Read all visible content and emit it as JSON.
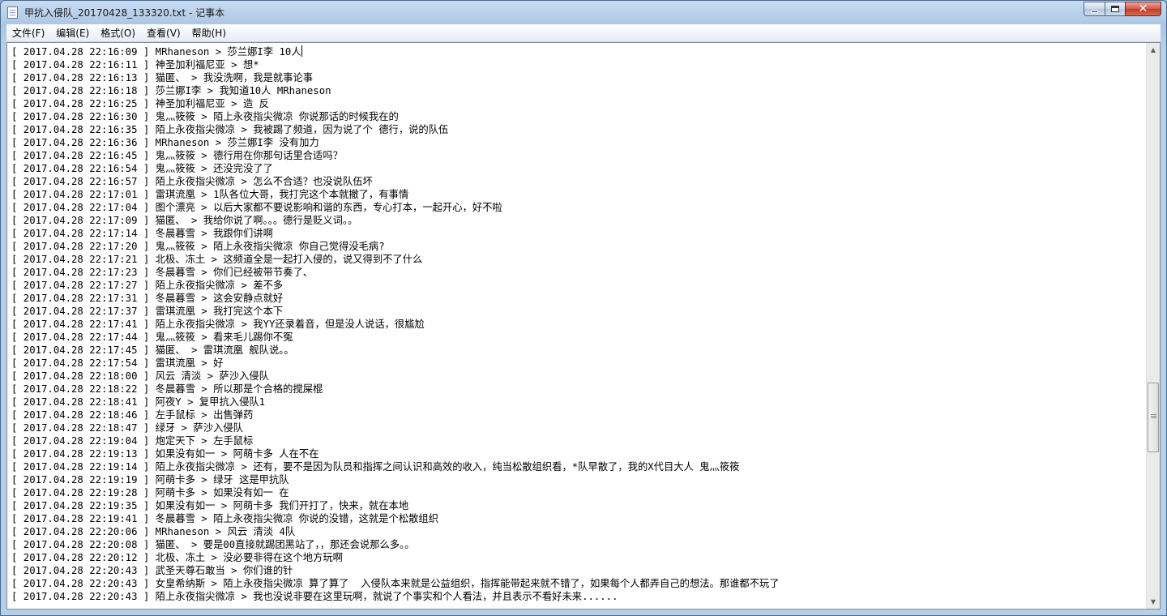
{
  "window": {
    "title": "甲抗入侵队_20170428_133320.txt - 记事本",
    "icon": "notepad-icon",
    "close_glyph": "✕"
  },
  "menu": [
    "文件(F)",
    "编辑(E)",
    "格式(O)",
    "查看(V)",
    "帮助(H)"
  ],
  "lines": [
    "[ 2017.04.28 22:16:09 ] MRhaneson > 莎兰娜I李 10人",
    "[ 2017.04.28 22:16:11 ] 神圣加利福尼亚 > 想*",
    "[ 2017.04.28 22:16:13 ] 猫匿、 > 我没洗啊，我是就事论事",
    "[ 2017.04.28 22:16:18 ] 莎兰娜I李 > 我知道10人 MRhaneson",
    "[ 2017.04.28 22:16:25 ] 神圣加利福尼亚 > 造 反",
    "[ 2017.04.28 22:16:30 ] 鬼灬筱筱 > 陌上永夜指尖微凉 你说那话的时候我在的",
    "[ 2017.04.28 22:16:35 ] 陌上永夜指尖微凉 > 我被踢了频道，因为说了个 德行，说的队伍",
    "[ 2017.04.28 22:16:36 ] MRhaneson > 莎兰娜I李 没有加力",
    "[ 2017.04.28 22:16:45 ] 鬼灬筱筱 > 德行用在你那句话里合适吗？",
    "[ 2017.04.28 22:16:54 ] 鬼灬筱筱 > 还没完没了了",
    "[ 2017.04.28 22:16:57 ] 陌上永夜指尖微凉 > 怎么不合适？也没说队伍坏",
    "[ 2017.04.28 22:17:01 ] 雷琪流凰 > 1队各位大哥，我打完这个本就撤了，有事情",
    "[ 2017.04.28 22:17:04 ] 图个漂亮 > 以后大家都不要说影响和谐的东西，专心打本，一起开心，好不啦",
    "[ 2017.04.28 22:17:09 ] 猫匿、 > 我给你说了啊。。。德行是贬义词。。",
    "[ 2017.04.28 22:17:14 ] 冬晨暮雪 > 我跟你们讲啊",
    "[ 2017.04.28 22:17:20 ] 鬼灬筱筱 > 陌上永夜指尖微凉 你自己觉得没毛病?",
    "[ 2017.04.28 22:17:21 ] 北极、冻土 > 这频道全是一起打入侵的，说又得到不了什么",
    "[ 2017.04.28 22:17:23 ] 冬晨暮雪 > 你们已经被带节奏了、",
    "[ 2017.04.28 22:17:27 ] 陌上永夜指尖微凉 > 差不多",
    "[ 2017.04.28 22:17:31 ] 冬晨暮雪 > 这会安静点就好",
    "[ 2017.04.28 22:17:37 ] 雷琪流凰 > 我打完这个本下",
    "[ 2017.04.28 22:17:41 ] 陌上永夜指尖微凉 > 我YY还录着音，但是没人说话，很尴尬",
    "[ 2017.04.28 22:17:44 ] 鬼灬筱筱 > 看来毛儿踢你不冤",
    "[ 2017.04.28 22:17:45 ] 猫匿、 > 雷琪流凰 舰队说。。",
    "[ 2017.04.28 22:17:54 ] 雷琪流凰 > 好",
    "[ 2017.04.28 22:18:00 ] 风云 清淡 > 萨沙入侵队",
    "[ 2017.04.28 22:18:22 ] 冬晨暮雪 > 所以那是个合格的搅屎棍",
    "[ 2017.04.28 22:18:41 ] 阿夜Y > 复甲抗入侵队1",
    "[ 2017.04.28 22:18:46 ] 左手鼠标 > 出售弹药",
    "[ 2017.04.28 22:18:47 ] 绿牙 > 萨沙入侵队",
    "[ 2017.04.28 22:19:04 ] 炮定天下 > 左手鼠标",
    "[ 2017.04.28 22:19:13 ] 如果没有如一 > 阿萌卡多 人在不在",
    "[ 2017.04.28 22:19:14 ] 陌上永夜指尖微凉 > 还有，要不是因为队员和指挥之间认识和高效的收入，纯当松散组织看，*队早散了，我的X代目大人 鬼灬筱筱",
    "[ 2017.04.28 22:19:19 ] 阿萌卡多 > 绿牙 这是甲抗队",
    "[ 2017.04.28 22:19:28 ] 阿萌卡多 > 如果没有如一 在",
    "[ 2017.04.28 22:19:35 ] 如果没有如一 > 阿萌卡多 我们开打了，快来，就在本地",
    "[ 2017.04.28 22:19:41 ] 冬晨暮雪 > 陌上永夜指尖微凉 你说的没错，这就是个松散组织",
    "[ 2017.04.28 22:20:06 ] MRhaneson > 风云 清淡 4队",
    "[ 2017.04.28 22:20:08 ] 猫匿、 > 要是00直接就踢团黑站了，，那还会说那么多。。",
    "[ 2017.04.28 22:20:12 ] 北极、冻土 > 没必要非得在这个地方玩啊",
    "[ 2017.04.28 22:20:43 ] 武圣天尊石敢当 > 你们谁的针",
    "[ 2017.04.28 22:20:43 ] 女皇希纳斯 > 陌上永夜指尖微凉 算了算了  入侵队本来就是公益组织，指挥能带起来就不错了，如果每个人都弄自己的想法。那谁都不玩了",
    "[ 2017.04.28 22:20:43 ] 陌上永夜指尖微凉 > 我也没说非要在这里玩啊，就说了个事实和个人看法，并且表示不看好未来......"
  ]
}
